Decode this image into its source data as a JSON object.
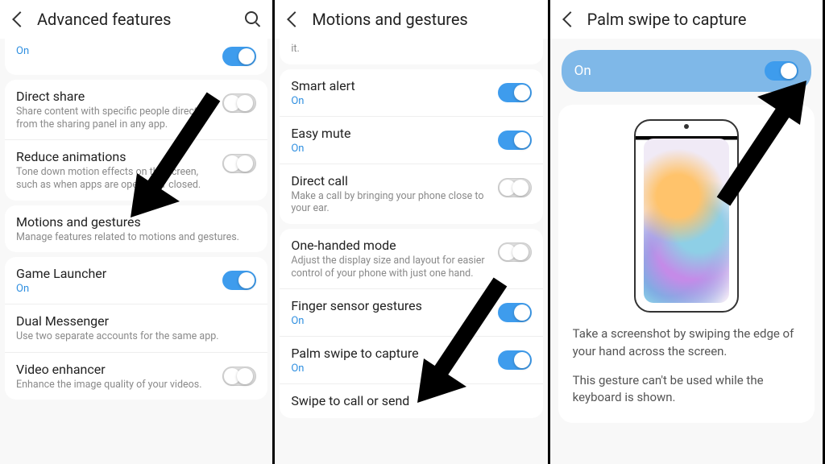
{
  "panel1": {
    "title": "Advanced features",
    "trail_state": "On",
    "rows": [
      {
        "title": "Direct share",
        "sub": "Share content with specific people directly from the sharing panel in any app.",
        "toggle": "off"
      },
      {
        "title": "Reduce animations",
        "sub": "Tone down motion effects on the screen, such as when apps are opened or closed.",
        "toggle": "off"
      },
      {
        "title": "Motions and gestures",
        "sub": "Manage features related to motions and gestures."
      },
      {
        "title": "Game Launcher",
        "state": "On",
        "toggle": "on"
      },
      {
        "title": "Dual Messenger",
        "sub": "Use two separate accounts for the same app."
      },
      {
        "title": "Video enhancer",
        "sub": "Enhance the image quality of your videos.",
        "toggle": "off"
      }
    ]
  },
  "panel2": {
    "title": "Motions and gestures",
    "trail_text": "it.",
    "rows": [
      {
        "title": "Smart alert",
        "state": "On",
        "toggle": "on"
      },
      {
        "title": "Easy mute",
        "state": "On",
        "toggle": "on"
      },
      {
        "title": "Direct call",
        "sub": "Make a call by bringing your phone close to your ear.",
        "toggle": "off"
      },
      {
        "title": "One-handed mode",
        "sub": "Adjust the display size and layout for easier control of your phone with just one hand.",
        "toggle": "off"
      },
      {
        "title": "Finger sensor gestures",
        "state": "On",
        "toggle": "on"
      },
      {
        "title": "Palm swipe to capture",
        "state": "On",
        "toggle": "on"
      },
      {
        "title": "Swipe to call or send"
      }
    ]
  },
  "panel3": {
    "title": "Palm swipe to capture",
    "state": "On",
    "info1": "Take a screenshot by swiping the edge of your hand across the screen.",
    "info2": "This gesture can't be used while the keyboard is shown."
  }
}
